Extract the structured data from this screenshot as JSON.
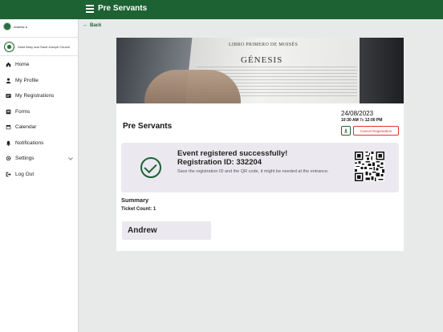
{
  "topbar": {
    "title": "Pre Servants"
  },
  "sidebar": {
    "user_name": "Andrew a",
    "church_name": "Saint Mary and Saint Joseph Church",
    "items": [
      {
        "label": "Home",
        "icon": "home-icon"
      },
      {
        "label": "My Profile",
        "icon": "person-icon"
      },
      {
        "label": "My Registrations",
        "icon": "registrations-icon"
      },
      {
        "label": "Forms",
        "icon": "form-icon"
      },
      {
        "label": "Calendar",
        "icon": "calendar-icon"
      },
      {
        "label": "Notifications",
        "icon": "bell-icon"
      },
      {
        "label": "Settings",
        "icon": "gear-icon"
      },
      {
        "label": "Log Out",
        "icon": "logout-icon"
      }
    ]
  },
  "back_label": "Back",
  "banner": {
    "line1": "LIBRO PRIMERO DE MOISÉS",
    "line2": "GÉNESIS"
  },
  "event": {
    "title": "Pre Servants",
    "date": "24/08/2023",
    "time_start": "10:30 AM",
    "time_sep": " To ",
    "time_end": "12:00 PM",
    "cancel_label": "Cancel Registration"
  },
  "success": {
    "title": "Event registered successfully!",
    "registration": "Registration ID: 332204",
    "note": "Save the registration ID and the QR code, it might be needed at the entrance."
  },
  "summary": {
    "heading": "Summary",
    "ticket_count": "Ticket Count: 1",
    "attendee": "Andrew"
  },
  "colors": {
    "brand": "#1d6233",
    "danger": "#dd3333",
    "panel": "#ebe9ef"
  }
}
